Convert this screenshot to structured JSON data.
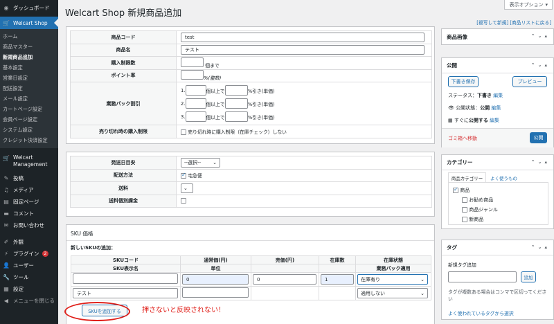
{
  "sidebar": {
    "dashboard": "ダッシュボード",
    "welcart_shop": "Welcart Shop",
    "submenu": [
      "ホーム",
      "商品マスター",
      "新規商品追加",
      "基本設定",
      "営業日設定",
      "配送設定",
      "メール設定",
      "カートページ設定",
      "会員ページ設定",
      "システム設定",
      "クレジット決済設定"
    ],
    "welcart_management": "Welcart Management",
    "posts": "投稿",
    "media": "メディア",
    "pages": "固定ページ",
    "comments": "コメント",
    "contact": "お問い合わせ",
    "appearance": "外観",
    "plugins": "プラグイン",
    "plugins_badge": "2",
    "users": "ユーザー",
    "tools": "ツール",
    "settings": "設定",
    "collapse": "メニューを閉じる"
  },
  "header": {
    "title": "Welcart Shop 新規商品追加",
    "screen_options": "表示オプション",
    "copy_new": "[複写して新規]",
    "back_to_list": "[商品リストに戻る]"
  },
  "product_form": {
    "code_label": "商品コード",
    "code_value": "test",
    "name_label": "商品名",
    "name_value": "テスト",
    "purchase_limit_label": "購入制限数",
    "purchase_limit_suffix": "個まで",
    "point_rate_label": "ポイント率",
    "point_rate_suffix": "%(整数)",
    "bulk_discount_label": "業務パック割引",
    "bulk_rows": [
      {
        "num": "1.",
        "mid": "個以上で",
        "suffix": "%引き(単価)"
      },
      {
        "num": "2.",
        "mid": "個以上で",
        "suffix": "%引き(単価)"
      },
      {
        "num": "3.",
        "mid": "個以上で",
        "suffix": "%引き(単価)"
      }
    ],
    "soldout_label": "売り切れ時の購入制限",
    "soldout_option": "売り切れ時に購入制限（在庫チェック）しない"
  },
  "shipping_form": {
    "ship_day_label": "発送日目安",
    "ship_day_value": "--選択--",
    "method_label": "配送方法",
    "method_value": "宅急便",
    "fee_label": "送料",
    "individual_label": "送料個別課金"
  },
  "sku": {
    "section_title": "SKU 価格",
    "new_label": "新しいSKUの追加：",
    "headers_top": [
      "SKUコード",
      "通常価(円)",
      "売価(円)",
      "在庫数",
      "在庫状態"
    ],
    "headers_bottom": [
      "SKU表示名",
      "単位",
      "",
      "",
      "業務パック適用"
    ],
    "row_name": "テスト",
    "row_regular": "0",
    "row_price": "0",
    "row_stock": "1",
    "row_status": "在庫有り",
    "row_pack": "適用しない",
    "add_button": "SKUを追加する",
    "annotation": "押さないと反映されない！"
  },
  "right": {
    "image_box_title": "商品画像",
    "publish_title": "公開",
    "save_draft": "下書き保存",
    "preview": "プレビュー",
    "status_label": "ステータス：",
    "status_value": "下書き",
    "visibility_label": "公開状態：",
    "visibility_value": "公開",
    "publish_time_label": "すぐに",
    "publish_time_value": "公開する",
    "edit": "編集",
    "trash": "ゴミ箱へ移動",
    "publish_btn": "公開",
    "category_title": "カテゴリー",
    "cat_tab1": "商品カテゴリー",
    "cat_tab2": "よく使うもの",
    "categories": [
      "商品",
      "お勧め商品",
      "商品ジャンル",
      "新商品"
    ],
    "tag_title": "タグ",
    "tag_add_label": "新規タグ追加",
    "tag_add_btn": "追加",
    "tag_help": "タグが複数ある場合はコンマで区切ってください",
    "tag_popular": "よく使われているタグから選択"
  }
}
